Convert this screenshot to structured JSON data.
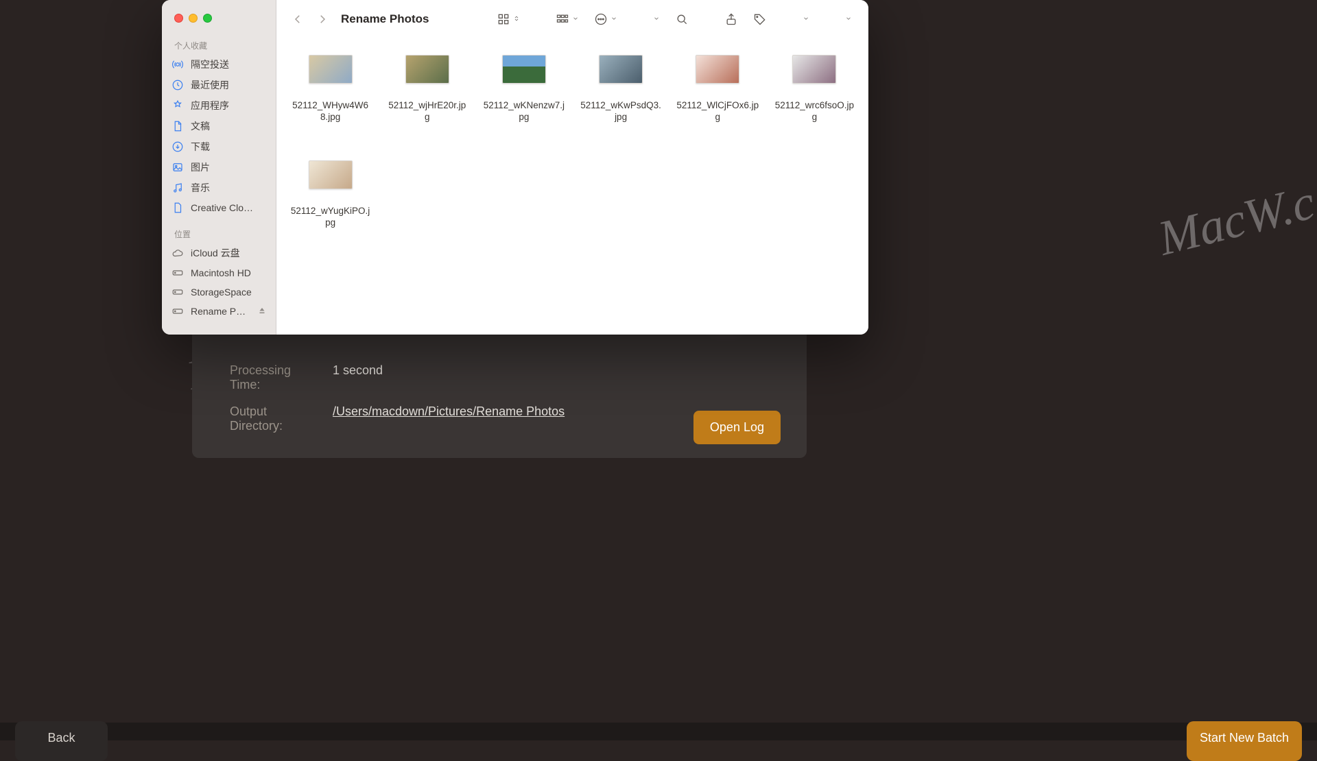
{
  "watermarks": {
    "wm1": "MacW",
    "wm2": "MacW.c",
    "wm3": "MacW\n.com"
  },
  "bg_app": {
    "proc_time_label": "Processing Time:",
    "proc_time_value": "1 second",
    "out_dir_label": "Output Directory:",
    "out_dir_value": "/Users/macdown/Pictures/Rename Photos",
    "btn_open_log": "Open Log"
  },
  "bottom": {
    "back": "Back",
    "start": "Start New Batch"
  },
  "finder": {
    "title": "Rename Photos",
    "sidebar": {
      "section_fav": "个人收藏",
      "fav": [
        {
          "label": "隔空投送",
          "icon": "airdrop"
        },
        {
          "label": "最近使用",
          "icon": "recents"
        },
        {
          "label": "应用程序",
          "icon": "apps"
        },
        {
          "label": "文稿",
          "icon": "documents"
        },
        {
          "label": "下载",
          "icon": "downloads"
        },
        {
          "label": "图片",
          "icon": "pictures"
        },
        {
          "label": "音乐",
          "icon": "music"
        },
        {
          "label": "Creative Clo…",
          "icon": "file"
        }
      ],
      "section_loc": "位置",
      "loc": [
        {
          "label": "iCloud 云盘",
          "icon": "cloud"
        },
        {
          "label": "Macintosh HD",
          "icon": "disk"
        },
        {
          "label": "StorageSpace",
          "icon": "disk"
        },
        {
          "label": "Rename P…",
          "icon": "disk",
          "ejectable": true
        }
      ]
    },
    "files": [
      {
        "name": "52112_WHyw4W68.jpg",
        "thumb": "th1"
      },
      {
        "name": "52112_wjHrE20r.jpg",
        "thumb": "th2"
      },
      {
        "name": "52112_wKNenzw7.jpg",
        "thumb": "th3"
      },
      {
        "name": "52112_wKwPsdQ3.jpg",
        "thumb": "th4"
      },
      {
        "name": "52112_WlCjFOx6.jpg",
        "thumb": "th5"
      },
      {
        "name": "52112_wrc6fsoO.jpg",
        "thumb": "th6"
      },
      {
        "name": "52112_wYugKiPO.jpg",
        "thumb": "th7"
      }
    ]
  }
}
